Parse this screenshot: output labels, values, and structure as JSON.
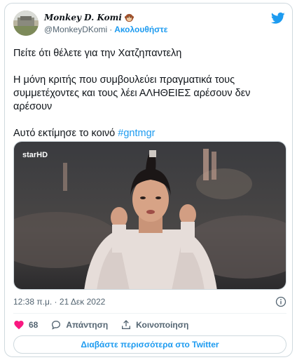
{
  "author": {
    "display_name": "Monkey D. Komi",
    "handle": "@MonkeyDKomi",
    "separator": "·",
    "follow_label": "Ακολουθήστε",
    "avatar_icon": "avatar-photo",
    "name_emoji": "monkey-face-icon"
  },
  "tweet": {
    "line1": "Πείτε ότι θέλετε για την Χατζηπαντελη",
    "line2": "Η μόνη κριτής που συμβουλεύει πραγματικά τους συμμετέχοντες και τους λέει ΑΛΗΘΕΙΕΣ αρέσουν δεν αρέσουν",
    "line3_text": "Αυτό εκτίμησε το κοινό",
    "hashtag": "#gntmgr"
  },
  "media": {
    "watermark": "starHD",
    "alt": "video still"
  },
  "meta": {
    "timestamp": "12:38 π.μ. · 21 Δεκ 2022",
    "info_icon": "info-icon"
  },
  "actions": {
    "like_count": "68",
    "reply_label": "Απάντηση",
    "share_label": "Κοινοποίηση"
  },
  "read_more_label": "Διαβάστε περισσότερα στο Twitter",
  "colors": {
    "accent": "#1d9bf0",
    "like": "#f91880",
    "text": "#0f1419",
    "muted": "#536471",
    "border": "#cfd9de"
  }
}
